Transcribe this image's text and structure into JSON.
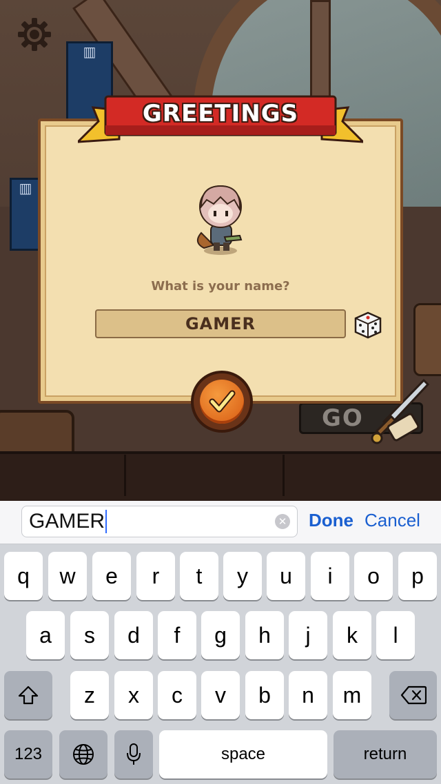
{
  "dialog": {
    "title": "GREETINGS",
    "question": "What is your name?",
    "name_value": "GAMER"
  },
  "background": {
    "go_label": "GO"
  },
  "input_bar": {
    "text_value": "GAMER",
    "done_label": "Done",
    "cancel_label": "Cancel",
    "clear_symbol": "✕"
  },
  "keyboard": {
    "row1": [
      "q",
      "w",
      "e",
      "r",
      "t",
      "y",
      "u",
      "i",
      "o",
      "p"
    ],
    "row2": [
      "a",
      "s",
      "d",
      "f",
      "g",
      "h",
      "j",
      "k",
      "l"
    ],
    "row3": [
      "z",
      "x",
      "c",
      "v",
      "b",
      "n",
      "m"
    ],
    "numbers_label": "123",
    "space_label": "space",
    "return_label": "return",
    "shift_icon": "⇧",
    "globe_icon": "globe-icon",
    "mic_icon": "microphone-icon",
    "backspace_icon": "backspace-icon"
  },
  "colors": {
    "accent_blue": "#1a5fd0",
    "panel_parchment": "#f3dfb0",
    "ribbon_red": "#d32a25",
    "confirm_orange": "#e2701e"
  }
}
